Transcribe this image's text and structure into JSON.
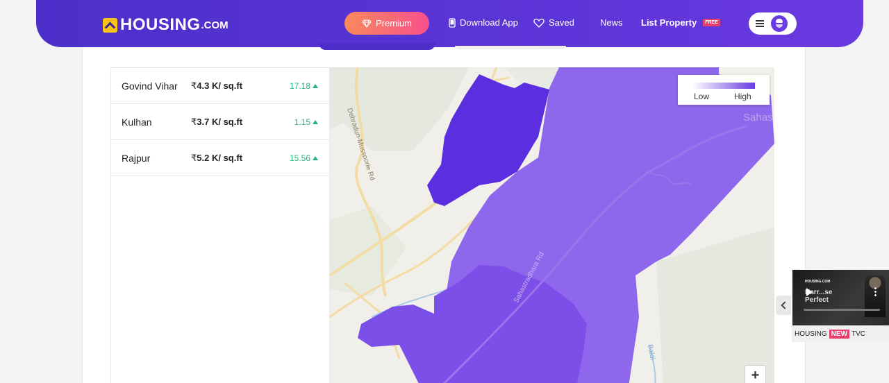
{
  "header": {
    "logo_text": "HOUSING",
    "logo_suffix": ".COM",
    "premium_label": "Premium",
    "download_label": "Download App",
    "saved_label": "Saved",
    "news_label": "News",
    "list_property_label": "List Property",
    "free_badge": "FREE"
  },
  "localities": [
    {
      "name": "Govind Vihar",
      "currency": "₹",
      "price": "4.3 K/ sq.ft",
      "change": "17.18",
      "trend": "up"
    },
    {
      "name": "Kulhan",
      "currency": "₹",
      "price": "3.7 K/ sq.ft",
      "change": "1.15",
      "trend": "up"
    },
    {
      "name": "Rajpur",
      "currency": "₹",
      "price": "5.2 K/ sq.ft",
      "change": "15.56",
      "trend": "up"
    }
  ],
  "map": {
    "legend_low": "Low",
    "legend_high": "High",
    "road_labels": [
      "Dehradun-Mussoorie Rd",
      "Sahastradhara Rd",
      "Baldi",
      "Sahas"
    ],
    "zoom_in_label": "+",
    "colors": {
      "high": "#5b2ee0",
      "mid": "#7c4fe8",
      "low": "#8f67ec"
    }
  },
  "video_widget": {
    "thumb_logo": "HOUSING.COM",
    "thumb_text_1": "Harr...se",
    "thumb_text_2": "Perfect",
    "caption_brand": "HOUSING",
    "caption_badge": "NEW",
    "caption_suffix": "TVC"
  },
  "colors": {
    "brand_purple": "#5b34d6",
    "premium_start": "#f9895c",
    "premium_end": "#f7508c",
    "positive_green": "#25b37a",
    "badge_pink": "#e63e6d"
  }
}
